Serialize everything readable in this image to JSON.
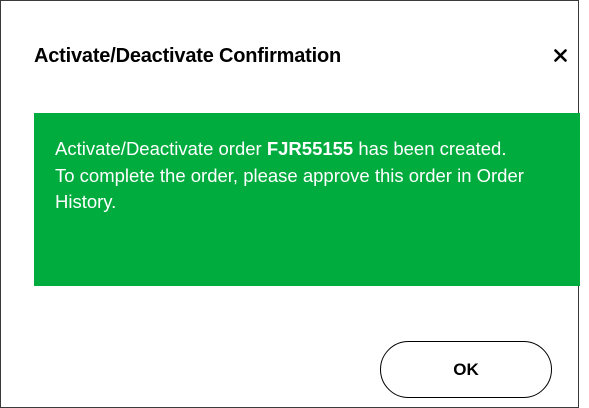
{
  "dialog": {
    "title": "Activate/Deactivate Confirmation",
    "close_icon": "close-icon",
    "message": {
      "prefix": "Activate/Deactivate order ",
      "order_id": "FJR55155",
      "suffix": " has been created.",
      "line2": "To complete the order, please approve this order in Order History."
    },
    "ok_label": "OK"
  },
  "colors": {
    "banner_background": "#00ac3e",
    "banner_text": "#ffffff",
    "title_text": "#000000",
    "button_border": "#000000"
  }
}
